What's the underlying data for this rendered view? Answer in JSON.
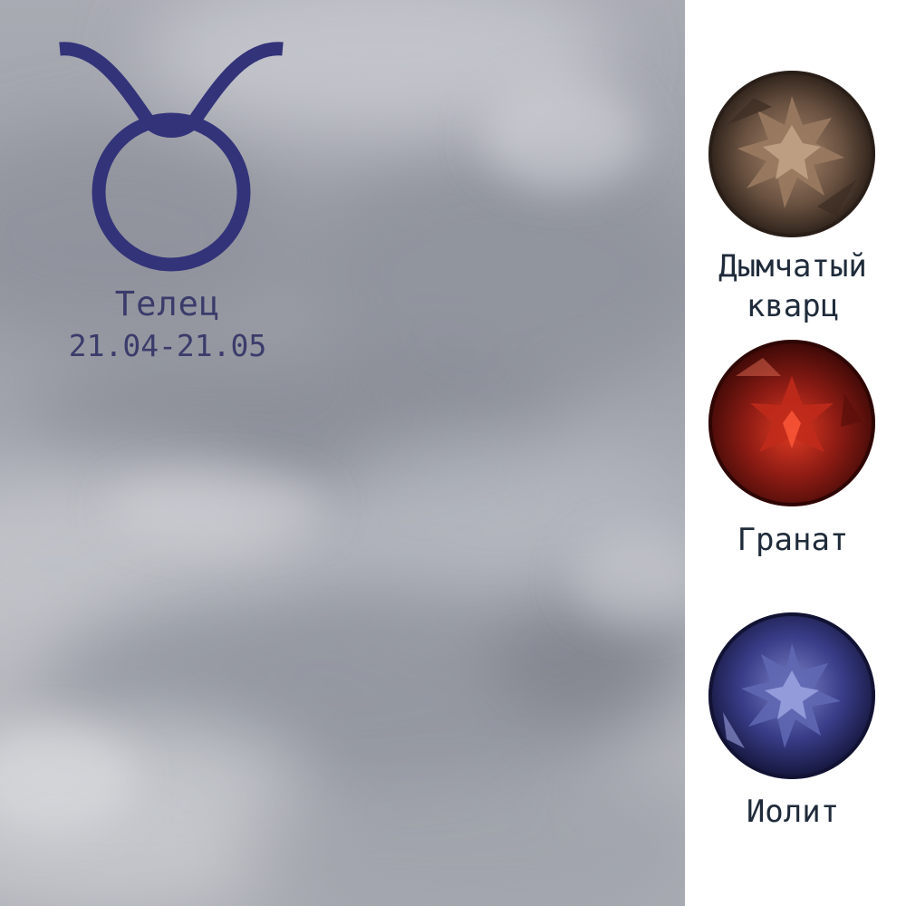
{
  "sign": {
    "name": "Телец",
    "dates": "21.04-21.05",
    "glyph_icon": "taurus-icon",
    "glyph_color": "#33337a"
  },
  "background": {
    "icon": "cloudy-sky-photo"
  },
  "stones": [
    {
      "label": "Дымчатый кварц",
      "icon": "smoky-quartz-gem-icon",
      "color": "#5a4638"
    },
    {
      "label": "Гранат",
      "icon": "garnet-gem-icon",
      "color": "#8a1a14"
    },
    {
      "label": "Иолит",
      "icon": "iolite-gem-icon",
      "color": "#3a3d8a"
    }
  ],
  "text_color": "#3b3b6b"
}
